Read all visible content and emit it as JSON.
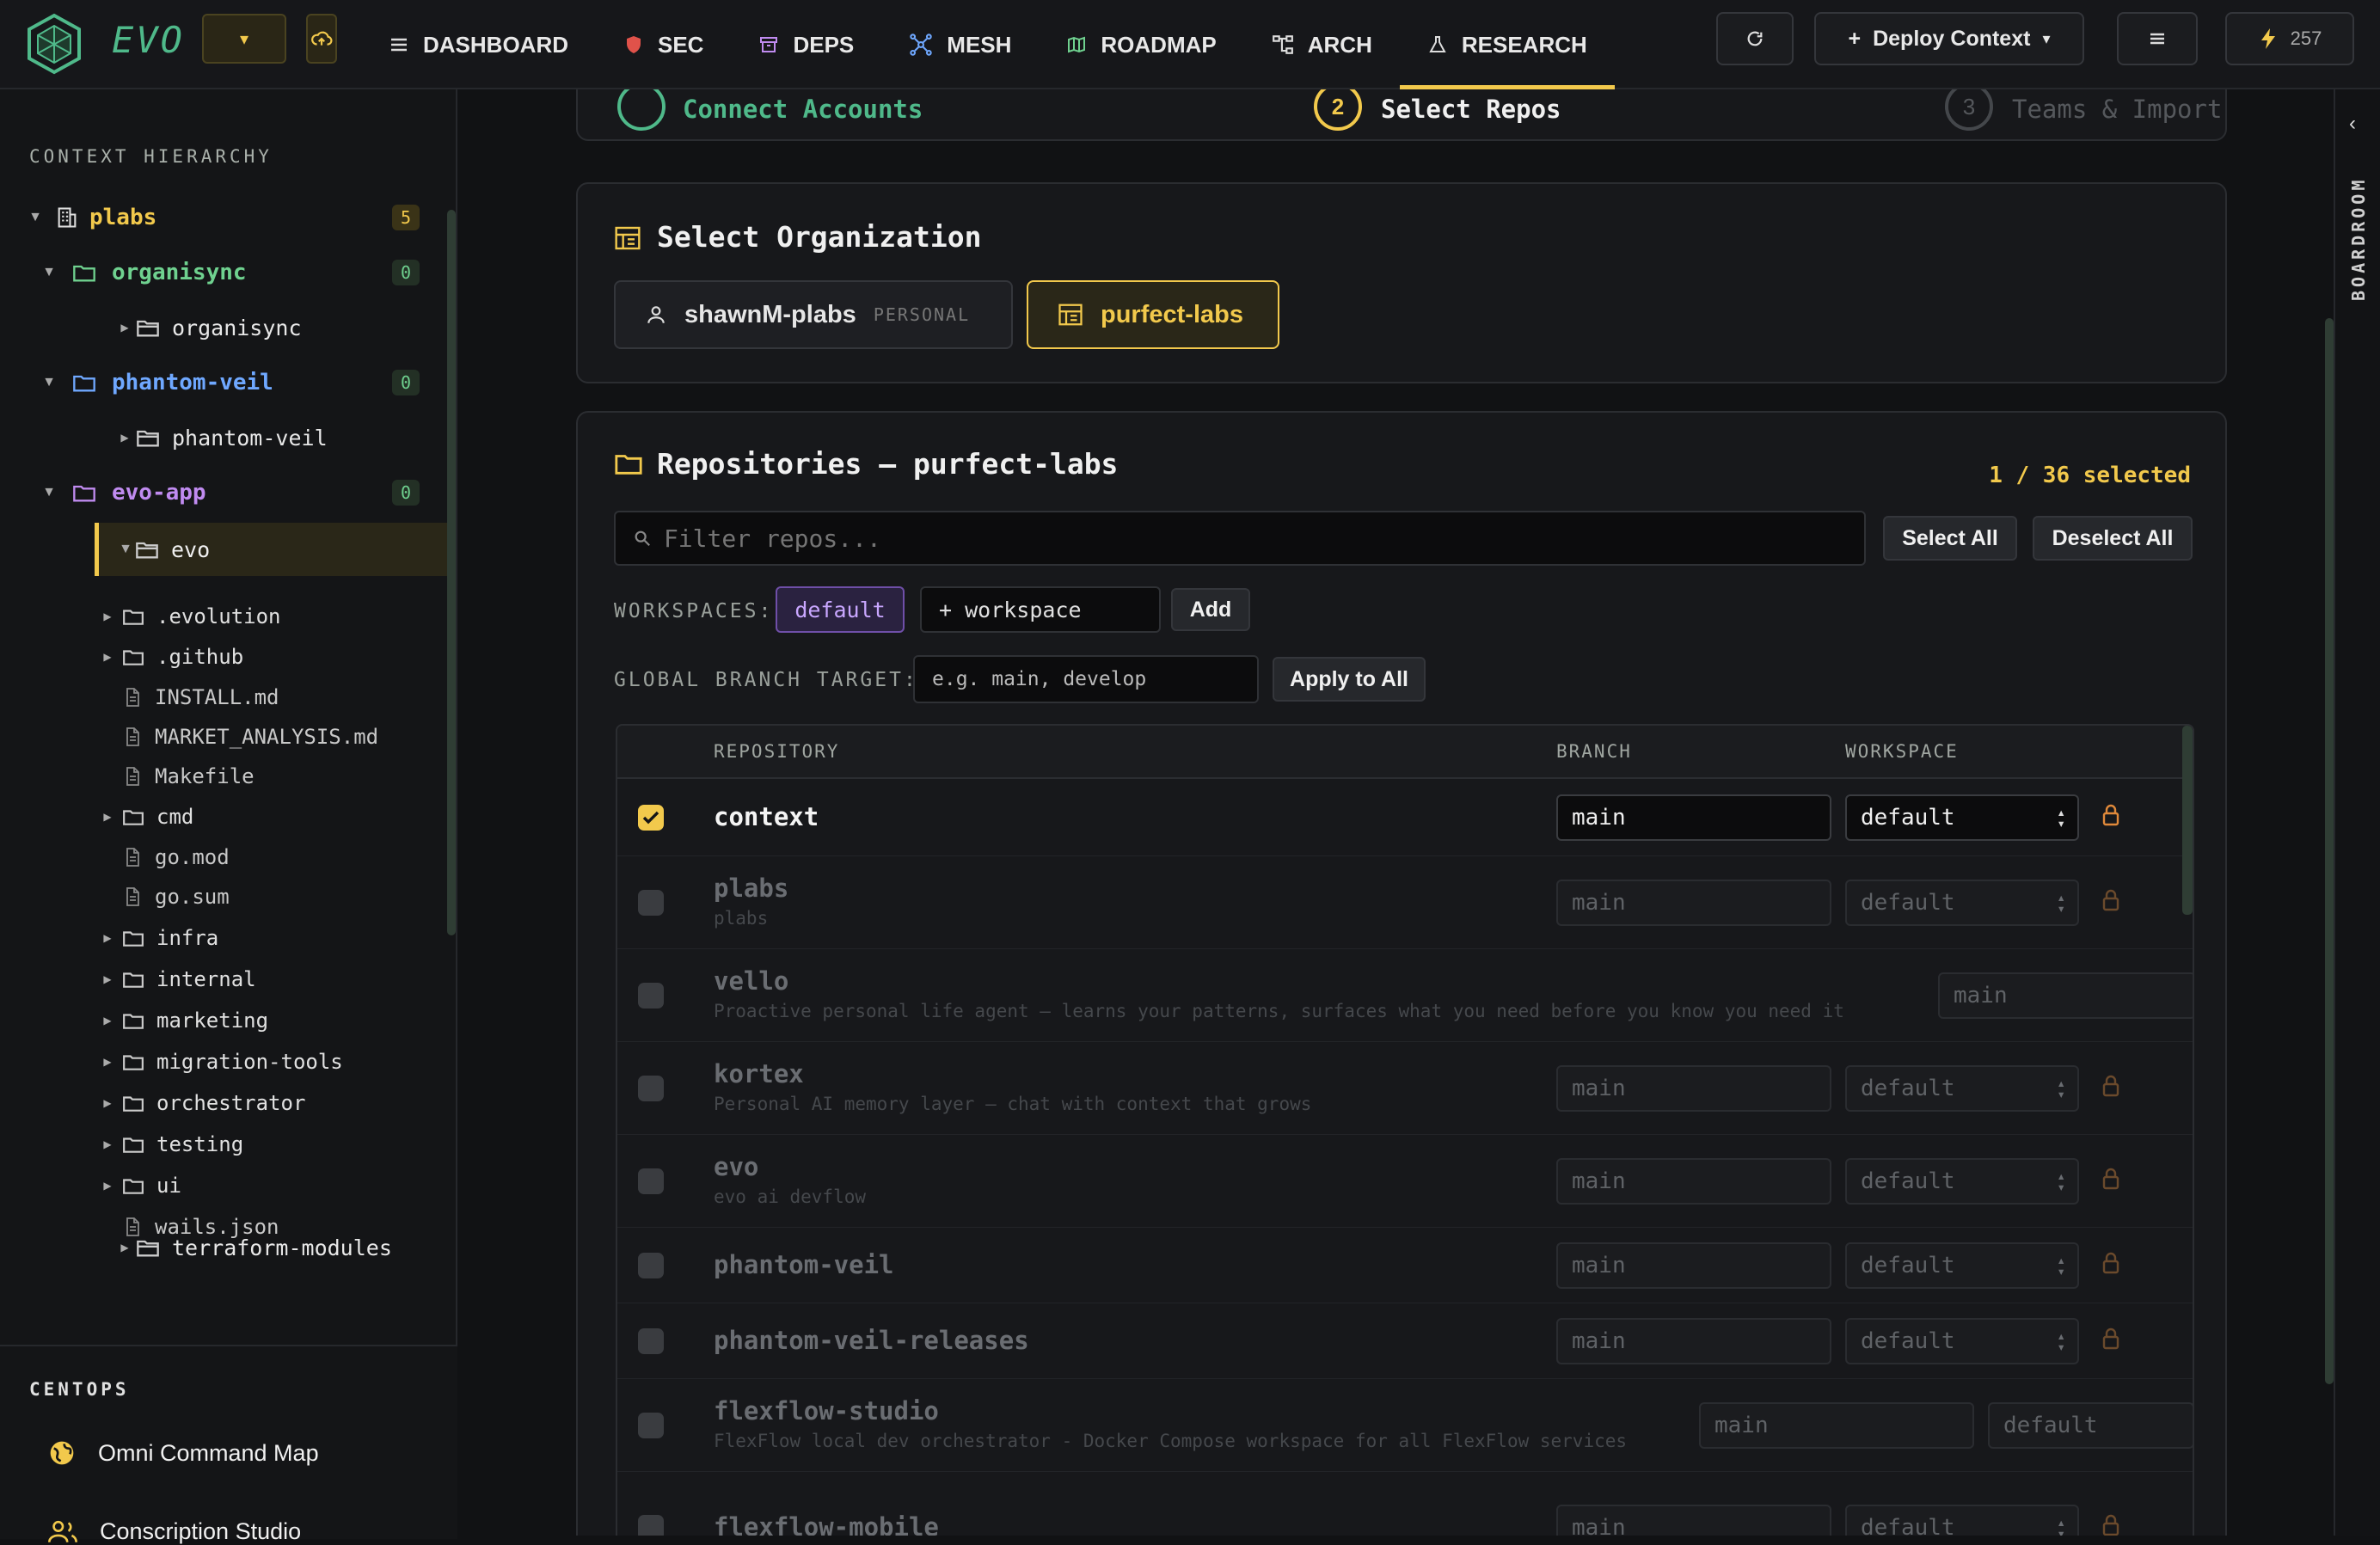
{
  "app": {
    "brand": "EVO"
  },
  "nav": {
    "items": [
      {
        "label": "DASHBOARD",
        "icon": "menu-icon"
      },
      {
        "label": "SEC",
        "icon": "shield-icon"
      },
      {
        "label": "DEPS",
        "icon": "package-icon"
      },
      {
        "label": "MESH",
        "icon": "network-icon"
      },
      {
        "label": "ROADMAP",
        "icon": "map-icon"
      },
      {
        "label": "ARCH",
        "icon": "tree-icon"
      },
      {
        "label": "RESEARCH",
        "icon": "flask-icon"
      }
    ],
    "active": "RESEARCH",
    "deploy_label": "Deploy Context",
    "energy_count": "257"
  },
  "sidebar": {
    "title": "CONTEXT HIERARCHY",
    "root": {
      "label": "plabs",
      "count": "5"
    },
    "groups": [
      {
        "label": "organisync",
        "count": "0",
        "child": "organisync"
      },
      {
        "label": "phantom-veil",
        "count": "0",
        "child": "phantom-veil"
      },
      {
        "label": "evo-app",
        "count": "0",
        "child": "evo"
      }
    ],
    "evo_children": [
      {
        "label": ".evolution",
        "type": "folder"
      },
      {
        "label": ".github",
        "type": "folder"
      },
      {
        "label": "INSTALL.md",
        "type": "file"
      },
      {
        "label": "MARKET_ANALYSIS.md",
        "type": "file"
      },
      {
        "label": "Makefile",
        "type": "file"
      },
      {
        "label": "cmd",
        "type": "folder"
      },
      {
        "label": "go.mod",
        "type": "file"
      },
      {
        "label": "go.sum",
        "type": "file"
      },
      {
        "label": "infra",
        "type": "folder"
      },
      {
        "label": "internal",
        "type": "folder"
      },
      {
        "label": "marketing",
        "type": "folder"
      },
      {
        "label": "migration-tools",
        "type": "folder"
      },
      {
        "label": "orchestrator",
        "type": "folder"
      },
      {
        "label": "testing",
        "type": "folder"
      },
      {
        "label": "ui",
        "type": "folder"
      },
      {
        "label": "wails.json",
        "type": "file"
      }
    ],
    "partial_item": "terraform-modules",
    "centops_title": "CENTOPS",
    "centops_items": [
      {
        "label": "Omni Command Map",
        "icon": "globe-icon"
      },
      {
        "label": "Conscription Studio",
        "icon": "users-icon"
      }
    ]
  },
  "stepper": {
    "steps": [
      "Connect Accounts",
      "Select Repos",
      "Teams & Import"
    ],
    "numbers": [
      "2",
      "3"
    ]
  },
  "org": {
    "title": "Select Organization",
    "options": [
      {
        "label": "shawnM-plabs",
        "tag": "PERSONAL"
      },
      {
        "label": "purfect-labs",
        "tag": ""
      }
    ],
    "selected": "purfect-labs"
  },
  "repos": {
    "title": "Repositories — purfect-labs",
    "selected_count": "1 / 36 selected",
    "filter_placeholder": "Filter repos...",
    "select_all": "Select All",
    "deselect_all": "Deselect All",
    "workspaces_label": "WORKSPACES:",
    "workspace_chip": "default",
    "workspace_input_placeholder": "+ workspace",
    "add_label": "Add",
    "branch_label": "GLOBAL BRANCH TARGET:",
    "branch_placeholder": "e.g. main, develop",
    "apply_label": "Apply to All",
    "columns": [
      "REPOSITORY",
      "BRANCH",
      "WORKSPACE"
    ],
    "rows": [
      {
        "name": "context",
        "desc": "",
        "branch": "main",
        "workspace": "default",
        "checked": true
      },
      {
        "name": "plabs",
        "desc": "plabs",
        "branch": "main",
        "workspace": "default",
        "checked": false
      },
      {
        "name": "vello",
        "desc": "Proactive personal life agent — learns your patterns, surfaces what you need before you know you need it",
        "branch": "main",
        "workspace": "",
        "checked": false
      },
      {
        "name": "kortex",
        "desc": "Personal AI memory layer — chat with context that grows",
        "branch": "main",
        "workspace": "default",
        "checked": false
      },
      {
        "name": "evo",
        "desc": "evo ai devflow",
        "branch": "main",
        "workspace": "default",
        "checked": false
      },
      {
        "name": "phantom-veil",
        "desc": "",
        "branch": "main",
        "workspace": "default",
        "checked": false
      },
      {
        "name": "phantom-veil-releases",
        "desc": "",
        "branch": "main",
        "workspace": "default",
        "checked": false
      },
      {
        "name": "flexflow-studio",
        "desc": "FlexFlow local dev orchestrator - Docker Compose workspace for all FlexFlow services",
        "branch": "main",
        "workspace": "default",
        "checked": false
      },
      {
        "name": "flexflow-mobile",
        "desc": "",
        "branch": "main",
        "workspace": "default",
        "checked": false
      }
    ]
  },
  "right_rail": {
    "label": "BOARDROOM"
  },
  "colors": {
    "accent": "#f2c94c",
    "green": "#4fb98a",
    "purple": "#c08bf0",
    "bg": "#111214"
  }
}
